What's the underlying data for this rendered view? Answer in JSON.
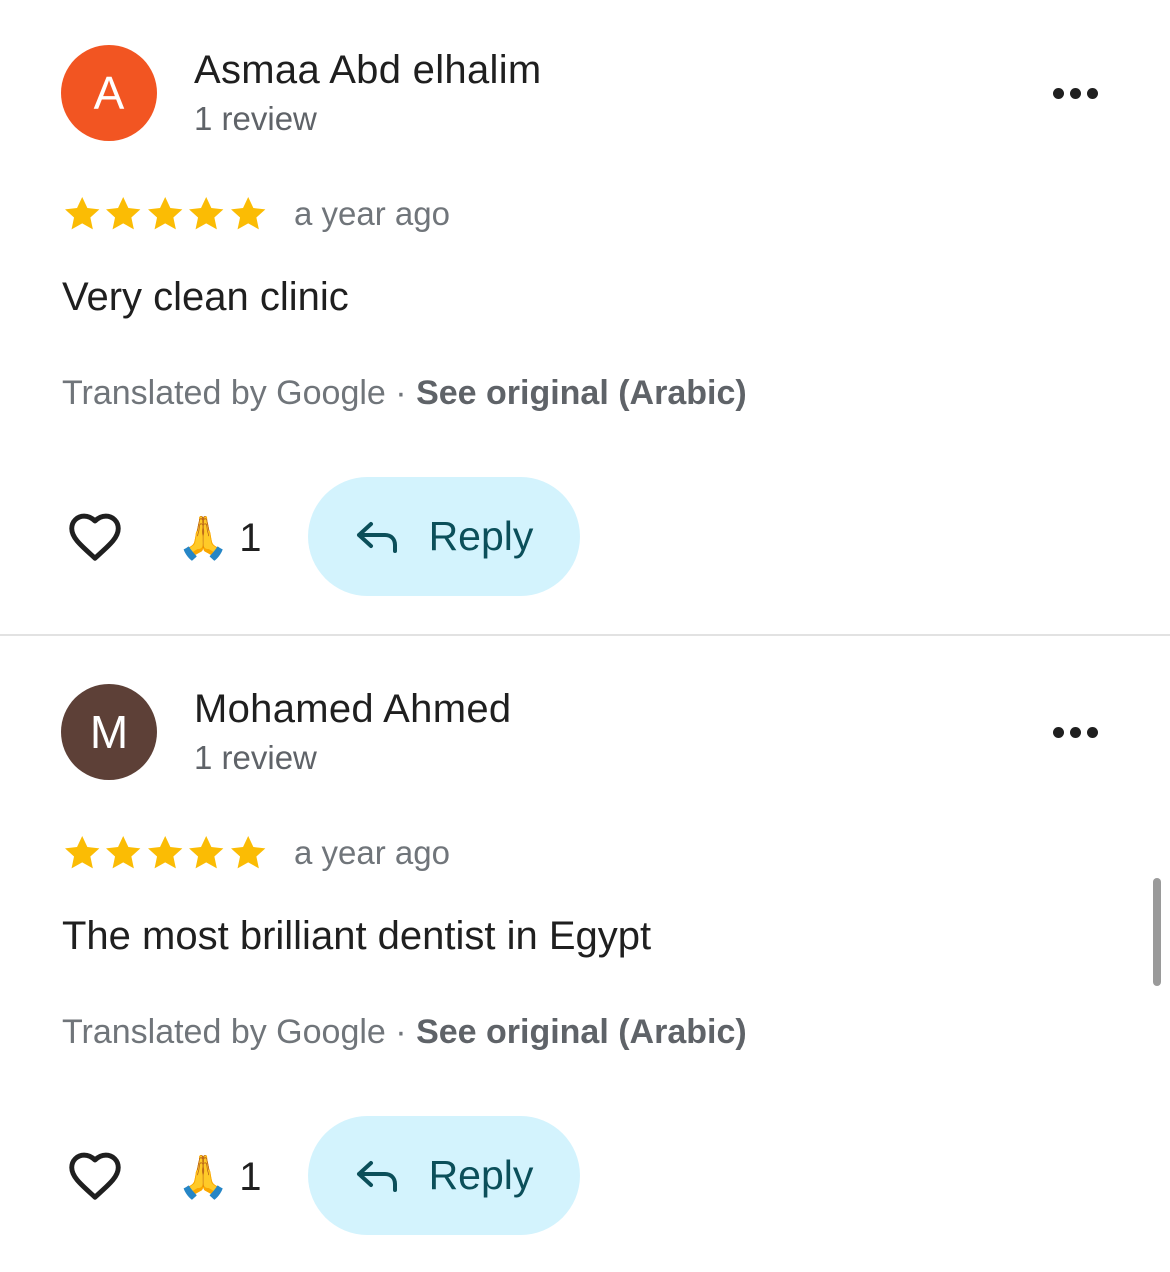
{
  "reviews": [
    {
      "avatar_letter": "A",
      "avatar_color": "#f25522",
      "name": "Asmaa Abd elhalim",
      "review_count": "1 review",
      "rating": 5,
      "time": "a year ago",
      "text": "Very clean clinic",
      "translated_by": "Translated by Google",
      "separator": "·",
      "see_original": "See original (Arabic)",
      "reaction_emoji": "🙏",
      "reaction_count": "1",
      "reply_label": "Reply"
    },
    {
      "avatar_letter": "M",
      "avatar_color": "#5d4037",
      "name": "Mohamed Ahmed",
      "review_count": "1 review",
      "rating": 5,
      "time": "a year ago",
      "text": "The most brilliant dentist in Egypt",
      "translated_by": "Translated by Google",
      "separator": "·",
      "see_original": "See original (Arabic)",
      "reaction_emoji": "🙏",
      "reaction_count": "1",
      "reply_label": "Reply"
    }
  ],
  "icons": {
    "more": "more-horizontal-icon",
    "star": "star-icon",
    "heart": "heart-outline-icon",
    "reply": "reply-arrow-icon"
  },
  "colors": {
    "star": "#fbbc04",
    "reply_bg": "#d3f3fd",
    "reply_text": "#0b4f5a",
    "secondary_text": "#70757a"
  }
}
